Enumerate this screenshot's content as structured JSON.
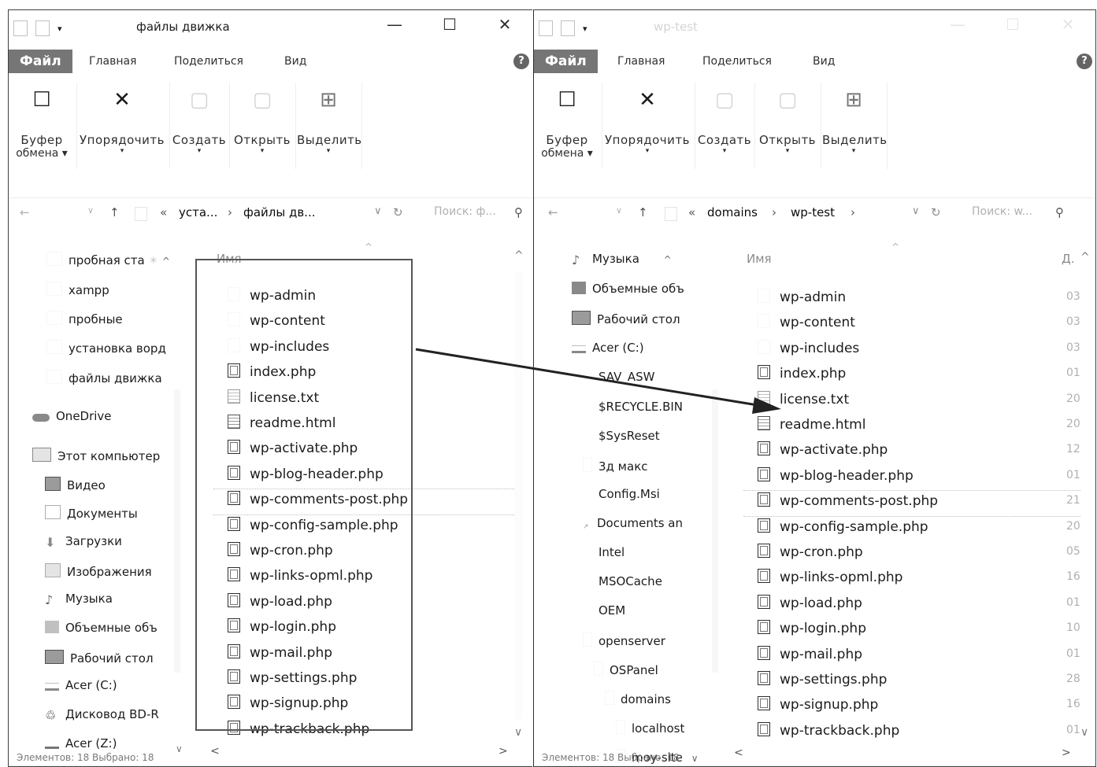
{
  "left": {
    "title": "файлы движка",
    "tabs": [
      "Файл",
      "Главная",
      "Поделиться",
      "Вид"
    ],
    "ribbon": [
      {
        "label": "Буфер",
        "sub": "обмена ▾"
      },
      {
        "label": "Упорядочить",
        "sub": "▾"
      },
      {
        "label": "Создать",
        "sub": "▾"
      },
      {
        "label": "Открыть",
        "sub": "▾"
      },
      {
        "label": "Выделить",
        "sub": "▾"
      }
    ],
    "address": {
      "prefix": "«",
      "crumb1": "уста...",
      "sep": "›",
      "crumb2": "файлы дв...",
      "dropdown": "∨",
      "refresh": "↻"
    },
    "search_placeholder": "Поиск: ф...",
    "nav": [
      {
        "label": "пробная ста"
      },
      {
        "label": "xampp"
      },
      {
        "label": "пробные"
      },
      {
        "label": "установка ворд"
      },
      {
        "label": "файлы движка"
      },
      {
        "label": "OneDrive"
      },
      {
        "label": "Этот компьютер"
      },
      {
        "label": "Видео"
      },
      {
        "label": "Документы"
      },
      {
        "label": "Загрузки"
      },
      {
        "label": "Изображения"
      },
      {
        "label": "Музыка"
      },
      {
        "label": "Объемные объ"
      },
      {
        "label": "Рабочий стол"
      },
      {
        "label": "Acer (C:)"
      },
      {
        "label": "Дисковод BD-R"
      },
      {
        "label": "Acer (Z:)"
      }
    ],
    "col_name": "Имя",
    "files": [
      "wp-admin",
      "wp-content",
      "wp-includes",
      "index.php",
      "license.txt",
      "readme.html",
      "wp-activate.php",
      "wp-blog-header.php",
      "wp-comments-post.php",
      "wp-config-sample.php",
      "wp-cron.php",
      "wp-links-opml.php",
      "wp-load.php",
      "wp-login.php",
      "wp-mail.php",
      "wp-settings.php",
      "wp-signup.php",
      "wp-trackback.php"
    ],
    "status": "Элементов: 18    Выбрано: 18"
  },
  "right": {
    "title": "wp-test",
    "tabs": [
      "Файл",
      "Главная",
      "Поделиться",
      "Вид"
    ],
    "ribbon": [
      {
        "label": "Буфер",
        "sub": "обмена ▾"
      },
      {
        "label": "Упорядочить",
        "sub": "▾"
      },
      {
        "label": "Создать",
        "sub": "▾"
      },
      {
        "label": "Открыть",
        "sub": "▾"
      },
      {
        "label": "Выделить",
        "sub": "▾"
      }
    ],
    "address": {
      "prefix": "«",
      "crumb1": "domains",
      "sep": "›",
      "crumb2": "wp-test",
      "sep2": "›",
      "dropdown": "∨",
      "refresh": "↻"
    },
    "search_placeholder": "Поиск: w...",
    "nav": [
      {
        "label": "Музыка"
      },
      {
        "label": "Объемные объ"
      },
      {
        "label": "Рабочий стол"
      },
      {
        "label": "Acer (C:)"
      },
      {
        "label": "SAV_ASW"
      },
      {
        "label": "$RECYCLE.BIN"
      },
      {
        "label": "$SysReset"
      },
      {
        "label": "3д макс"
      },
      {
        "label": "Config.Msi"
      },
      {
        "label": "Documents an"
      },
      {
        "label": "Intel"
      },
      {
        "label": "MSOCache"
      },
      {
        "label": "OEM"
      },
      {
        "label": "openserver"
      },
      {
        "label": "OSPanel"
      },
      {
        "label": "domains"
      },
      {
        "label": "localhost"
      },
      {
        "label": "moy-site"
      }
    ],
    "col_name": "Имя",
    "col_date": "Д.",
    "files": [
      "wp-admin",
      "wp-content",
      "wp-includes",
      "index.php",
      "license.txt",
      "readme.html",
      "wp-activate.php",
      "wp-blog-header.php",
      "wp-comments-post.php",
      "wp-config-sample.php",
      "wp-cron.php",
      "wp-links-opml.php",
      "wp-load.php",
      "wp-login.php",
      "wp-mail.php",
      "wp-settings.php",
      "wp-signup.php",
      "wp-trackback.php"
    ],
    "dates": [
      "03",
      "03",
      "03",
      "01",
      "20",
      "20",
      "12",
      "01",
      "21",
      "20",
      "05",
      "16",
      "01",
      "10",
      "01",
      "28",
      "16",
      "01"
    ],
    "status": "Элементов: 18    Выбрано: 18"
  }
}
